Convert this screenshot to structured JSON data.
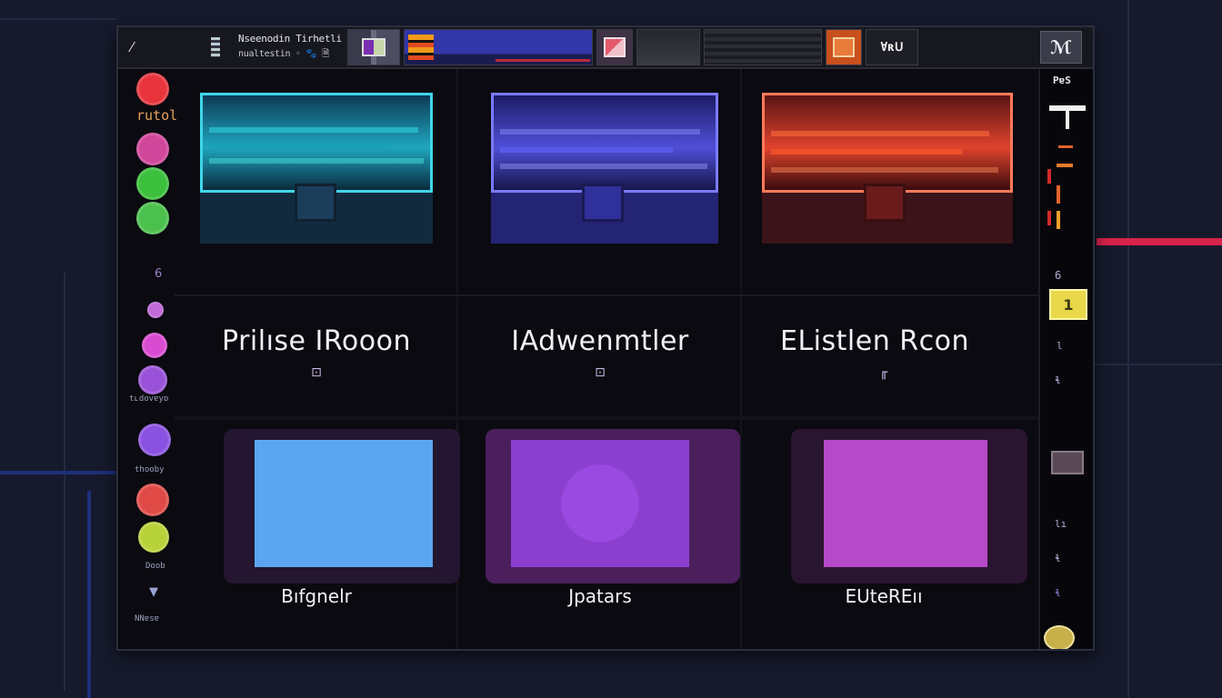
{
  "topbar": {
    "menu_icon": "⁄",
    "title_line1": "Nseenodin Tirhetli",
    "title_line2": "nualtestin ◦ 🐾 🗎",
    "badge_text": "Ɐʀᑌ",
    "logo_icon": "ℳ"
  },
  "left_sidebar": {
    "items": [
      {
        "label": "rutol",
        "color": "#e8343c"
      },
      {
        "label": "",
        "color": "#d0469a"
      },
      {
        "label": "",
        "color": "#3cbf3c"
      },
      {
        "label": "",
        "color": "#4cc04c"
      },
      {
        "label": "6",
        "color": ""
      },
      {
        "label": "",
        "color": "#c06ad8"
      },
      {
        "label": "",
        "color": "#d84ad0"
      },
      {
        "label": "tʟdovɐyɒ",
        "color": "#9a52d8"
      },
      {
        "label": "thooby",
        "color": "#8a52e0"
      },
      {
        "label": "",
        "color": "#e04a46"
      },
      {
        "label": "",
        "color": "#b8d23a"
      },
      {
        "label": "Doob",
        "color": ""
      },
      {
        "label": "NNɐsɐ",
        "color": ""
      }
    ]
  },
  "right_sidebar": {
    "top_label": "PɐS",
    "marker_label": "1",
    "side_numbers": [
      "6",
      "l",
      "ɬ",
      "lı",
      "ɬ",
      "ɬ"
    ]
  },
  "games": [
    {
      "title": "Prilıse IRooon",
      "subtitle": "⊡",
      "theme": "teal",
      "color_main": "#1fa6c0",
      "color_dark": "#0d3a55"
    },
    {
      "title": "IAdwenmtler",
      "subtitle": "⊡",
      "theme": "indigo",
      "color_main": "#4f4fd8",
      "color_dark": "#1c1c66"
    },
    {
      "title": "EListlen Rcon",
      "subtitle": "╓",
      "theme": "red",
      "color_main": "#e0432c",
      "color_dark": "#5a1414"
    }
  ],
  "categories": [
    {
      "title": "Bıfgnelr",
      "color_main": "#5aa6f0",
      "glow": "#2b1838"
    },
    {
      "title": "Jpatars",
      "color_main": "#8a3fcf",
      "glow": "#4b1e5c"
    },
    {
      "title": "EUteREıı",
      "color_main": "#b54ac8",
      "glow": "#2a1530"
    }
  ]
}
